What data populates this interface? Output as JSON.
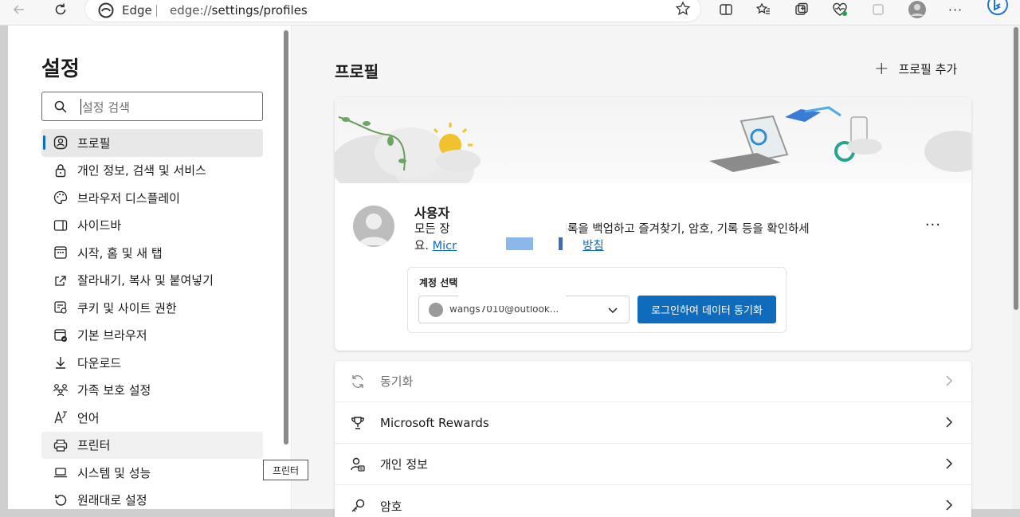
{
  "browser": {
    "site_label": "Edge",
    "url_prefix": "edge://",
    "url_path": "settings/profiles"
  },
  "sidebar": {
    "title": "설정",
    "search_placeholder": "설정 검색",
    "items": [
      {
        "label": "프로필",
        "icon": "profile-icon"
      },
      {
        "label": "개인 정보, 검색 및 서비스",
        "icon": "lock-icon"
      },
      {
        "label": "브라우저 디스플레이",
        "icon": "palette-icon"
      },
      {
        "label": "사이드바",
        "icon": "sidebar-icon"
      },
      {
        "label": "시작, 홈 및 새 탭",
        "icon": "home-grid-icon"
      },
      {
        "label": "잘라내기, 복사 및 붙여넣기",
        "icon": "share-icon"
      },
      {
        "label": "쿠키 및 사이트 권한",
        "icon": "site-permissions-icon"
      },
      {
        "label": "기본 브라우저",
        "icon": "default-browser-icon"
      },
      {
        "label": "다운로드",
        "icon": "download-icon"
      },
      {
        "label": "가족 보호 설정",
        "icon": "family-icon"
      },
      {
        "label": "언어",
        "icon": "language-icon"
      },
      {
        "label": "프린터",
        "icon": "printer-icon"
      },
      {
        "label": "시스템 및 성능",
        "icon": "laptop-icon"
      },
      {
        "label": "원래대로 설정",
        "icon": "reset-icon"
      }
    ],
    "tooltip": "프린터"
  },
  "main": {
    "title": "프로필",
    "add_profile": "프로필 추가",
    "profile": {
      "name": "사용자",
      "desc_line1_a": "모든 장",
      "desc_line1_b": "기록을 백업하고 즐겨찾기, 암호, 기록 등을 확인하세",
      "desc_line2_a": "요. ",
      "desc_link_a": "Micr",
      "desc_link_b": "방침",
      "account_label": "계정 선택",
      "account_email": "wangs7010@outlook...",
      "sync_button": "로그인하여 데이터 동기화",
      "more": "···"
    },
    "rows": [
      {
        "label": "동기화",
        "icon": "sync-icon",
        "disabled": true
      },
      {
        "label": "Microsoft Rewards",
        "icon": "trophy-icon",
        "disabled": false
      },
      {
        "label": "개인 정보",
        "icon": "personal-info-icon",
        "disabled": false
      },
      {
        "label": "암호",
        "icon": "key-icon",
        "disabled": false
      }
    ]
  },
  "colors": {
    "accent": "#0f6cbd",
    "sidebar_active": "#e8e8e8",
    "main_bg": "#f5f5f5"
  }
}
